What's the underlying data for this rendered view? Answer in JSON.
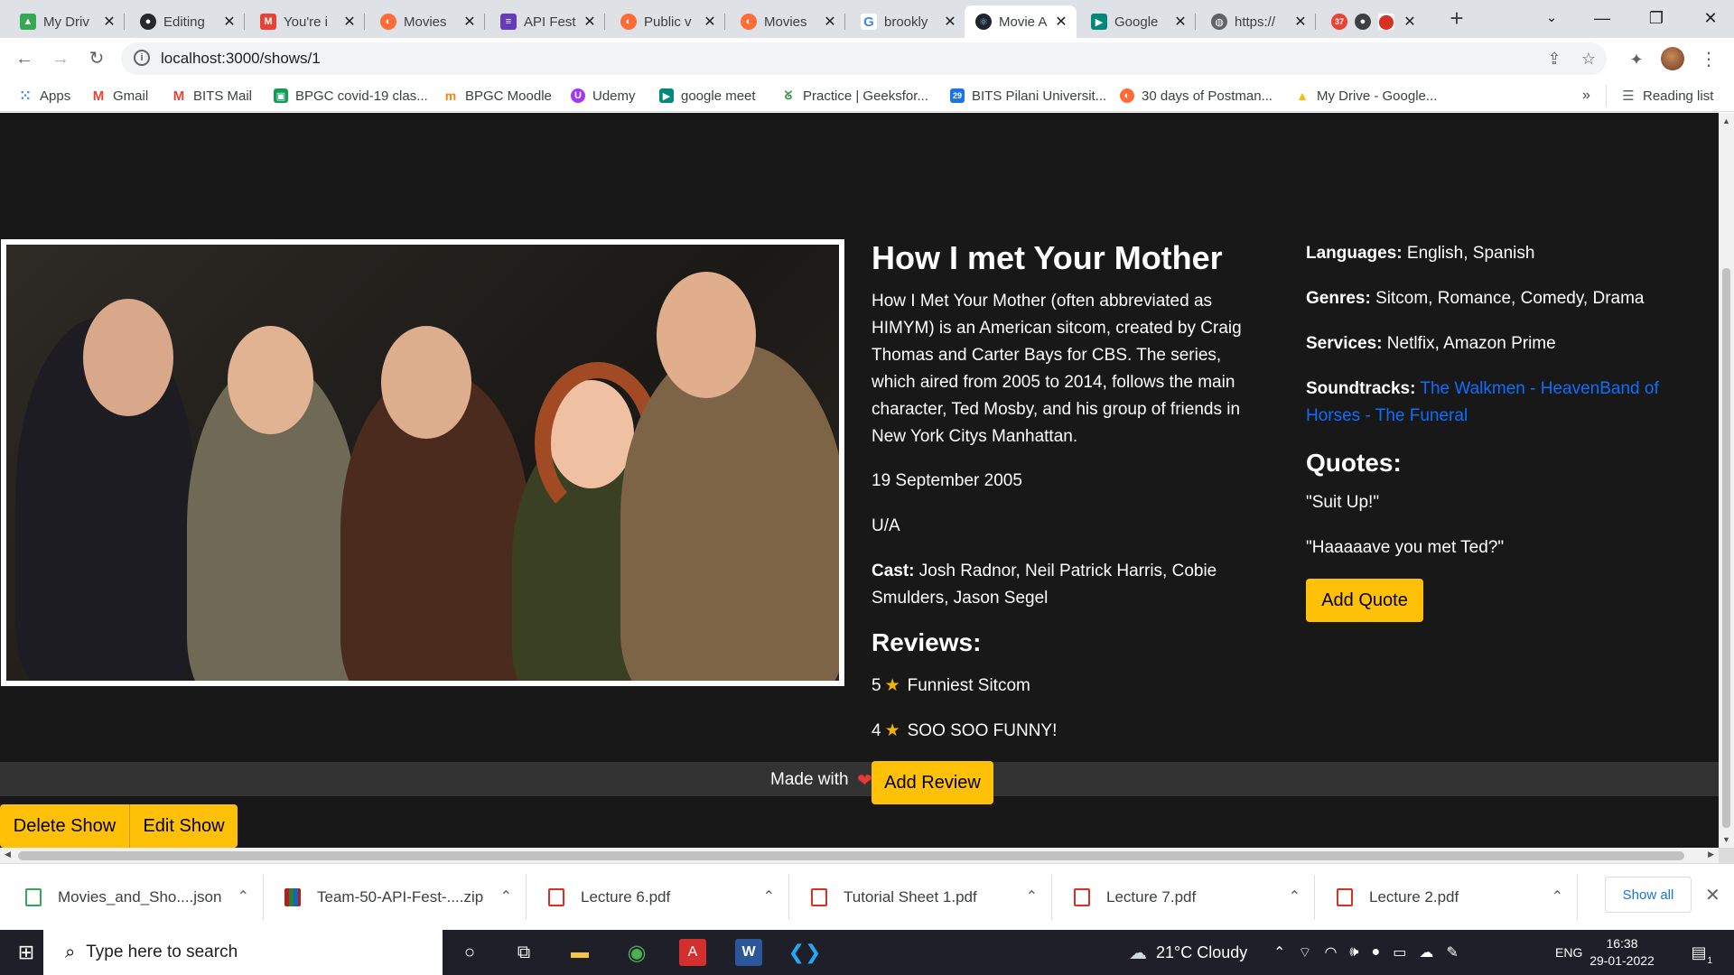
{
  "browser": {
    "tabs": [
      {
        "label": "My Driv",
        "icon": "google-drive-icon",
        "color": "#34a853"
      },
      {
        "label": "Editing",
        "icon": "github-icon",
        "color": "#24292e"
      },
      {
        "label": "You're i",
        "icon": "gmail-icon",
        "color": "#ea4335"
      },
      {
        "label": "Movies",
        "icon": "postman-icon",
        "color": "#ff6c37"
      },
      {
        "label": "API Fest",
        "icon": "forms-icon",
        "color": "#673ab7"
      },
      {
        "label": "Public v",
        "icon": "postman-icon",
        "color": "#ff6c37"
      },
      {
        "label": "Movies",
        "icon": "postman-icon",
        "color": "#ff6c37"
      },
      {
        "label": "brookly",
        "icon": "google-icon",
        "color": "#4285f4"
      },
      {
        "label": "Movie A",
        "icon": "react-icon",
        "color": "#61dafb"
      },
      {
        "label": "Google",
        "icon": "google-meet-icon",
        "color": "#00897b"
      },
      {
        "label": "https://",
        "icon": "globe-icon",
        "color": "#5f6368"
      }
    ],
    "extension_badge": "37",
    "url": "localhost:3000/shows/1",
    "reading_list": "Reading list",
    "bookmarks": [
      {
        "label": "Apps",
        "icon": "apps-grid-icon",
        "color": "#4285f4"
      },
      {
        "label": "Gmail",
        "icon": "gmail-icon",
        "color": "#ea4335"
      },
      {
        "label": "BITS Mail",
        "icon": "gmail-icon",
        "color": "#ea4335"
      },
      {
        "label": "BPGC covid-19 clas...",
        "icon": "classroom-icon",
        "color": "#0f9d58"
      },
      {
        "label": "BPGC Moodle",
        "icon": "moodle-icon",
        "color": "#f98012"
      },
      {
        "label": "Udemy",
        "icon": "udemy-icon",
        "color": "#a435f0"
      },
      {
        "label": "google meet",
        "icon": "google-meet-icon",
        "color": "#00897b"
      },
      {
        "label": "Practice | Geeksfor...",
        "icon": "geeksforgeeks-icon",
        "color": "#2f8d46"
      },
      {
        "label": "BITS Pilani Universit...",
        "icon": "calendar-icon",
        "color": "#1a73e8"
      },
      {
        "label": "30 days of Postman...",
        "icon": "postman-icon",
        "color": "#ff6c37"
      },
      {
        "label": "My Drive - Google...",
        "icon": "google-drive-icon",
        "color": "#34a853"
      }
    ]
  },
  "show": {
    "title": "How I met Your Mother",
    "description": "How I Met Your Mother (often abbreviated as HIMYM) is an American sitcom, created by Craig Thomas and Carter Bays for CBS. The series, which aired from 2005 to 2014, follows the main character, Ted Mosby, and his group of friends in New York Citys Manhattan.",
    "release_date": "19 September 2005",
    "rating": "U/A",
    "cast_label": "Cast:",
    "cast": "Josh Radnor, Neil Patrick Harris, Cobie Smulders, Jason Segel",
    "reviews_heading": "Reviews:",
    "reviews": [
      {
        "score": "5",
        "text": "Funniest Sitcom"
      },
      {
        "score": "4",
        "text": "SOO SOO FUNNY!"
      }
    ],
    "languages_label": "Languages:",
    "languages": "English, Spanish",
    "genres_label": "Genres:",
    "genres": "Sitcom, Romance, Comedy, Drama",
    "services_label": "Services:",
    "services": "Netlfix, Amazon Prime",
    "soundtracks_label": "Soundtracks:",
    "soundtracks": [
      "The Walkmen - Heaven",
      "Band of Horses - The Funeral"
    ],
    "quotes_heading": "Quotes:",
    "quotes": [
      "\"Suit Up!\"",
      "\"Haaaaave you met Ted?\""
    ],
    "add_quote": "Add Quote",
    "add_review": "Add Review",
    "delete_show": "Delete Show",
    "edit_show": "Edit Show",
    "footer_text": "Made with"
  },
  "downloads": {
    "items": [
      "Movies_and_Sho....json",
      "Team-50-API-Fest-....zip",
      "Lecture 6.pdf",
      "Tutorial Sheet 1.pdf",
      "Lecture 7.pdf",
      "Lecture 2.pdf"
    ],
    "show_all": "Show all"
  },
  "taskbar": {
    "search_placeholder": "Type here to search",
    "weather": "21°C  Cloudy",
    "language": "ENG",
    "time": "16:38",
    "date": "29-01-2022",
    "notification_count": "1"
  },
  "colors": {
    "accent_yellow": "#ffc107",
    "page_background": "#191818",
    "link_blue": "#0d6efd",
    "footer_bar": "#333333"
  }
}
